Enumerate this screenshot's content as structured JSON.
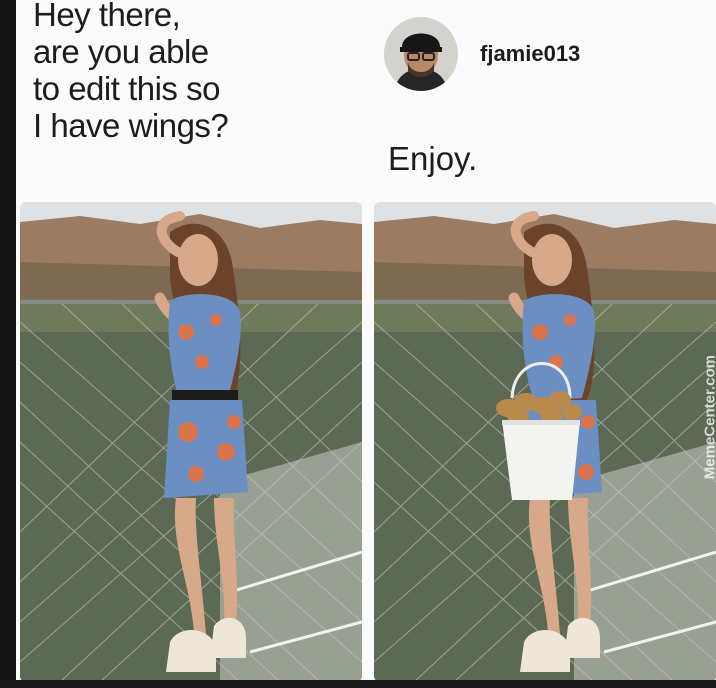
{
  "request": {
    "lines": [
      "Hey there,",
      "are you able",
      "to edit this so",
      "I have wings?"
    ]
  },
  "reply": {
    "username": "fjamie013",
    "text": "Enjoy."
  },
  "photos": {
    "left_description_icon": "original-photo",
    "right_description_icon": "edited-photo-bucket-of-chicken-wings"
  },
  "watermark": "MemeCenter.com",
  "colors": {
    "sky": "#dfe2e5",
    "cliff": "#9b7b62",
    "water": "#5c6a55",
    "dress_blue": "#6c8fc3",
    "dress_orange": "#d9744c",
    "bucket": "#f3f3f0",
    "wings": "#b98a4c"
  }
}
